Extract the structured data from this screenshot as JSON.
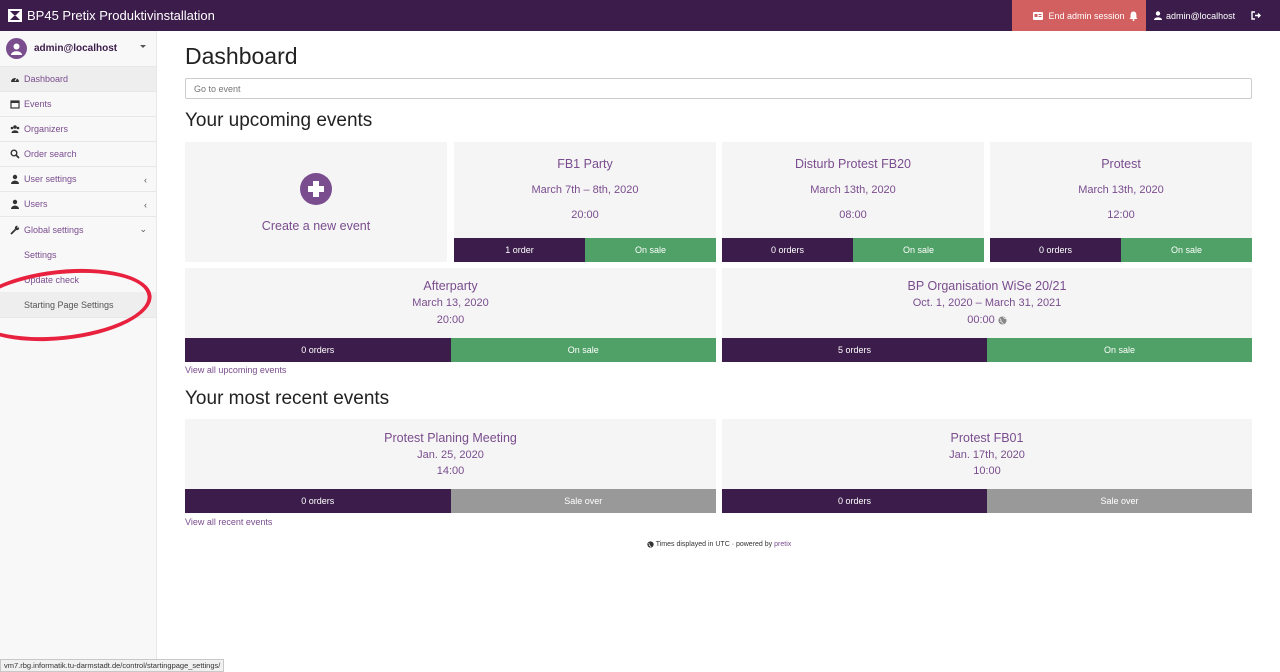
{
  "header": {
    "app_title": "BP45 Pretix Produktivinstallation",
    "end_admin_label": "End admin session",
    "user_label": "admin@localhost",
    "colors": {
      "topbar": "#3b1c4a",
      "end_admin": "#d36060"
    }
  },
  "sidebar": {
    "user": "admin@localhost",
    "items": [
      {
        "label": "Dashboard",
        "icon": "dashboard-icon"
      },
      {
        "label": "Events",
        "icon": "calendar-icon"
      },
      {
        "label": "Organizers",
        "icon": "group-icon"
      },
      {
        "label": "Order search",
        "icon": "search-icon"
      },
      {
        "label": "User settings",
        "icon": "user-icon"
      },
      {
        "label": "Users",
        "icon": "user-icon"
      },
      {
        "label": "Global settings",
        "icon": "wrench-icon"
      }
    ],
    "subitems": [
      {
        "label": "Settings"
      },
      {
        "label": "Update check"
      },
      {
        "label": "Starting Page Settings"
      }
    ]
  },
  "main": {
    "title": "Dashboard",
    "goto_placeholder": "Go to event",
    "upcoming_title": "Your upcoming events",
    "create_label": "Create a new event",
    "upcoming": [
      {
        "name": "FB1 Party",
        "date": "March 7th – 8th, 2020",
        "time": "20:00",
        "orders": "1 order",
        "status": "On sale"
      },
      {
        "name": "Disturb Protest FB20",
        "date": "March 13th, 2020",
        "time": "08:00",
        "orders": "0 orders",
        "status": "On sale"
      },
      {
        "name": "Protest",
        "date": "March 13th, 2020",
        "time": "12:00",
        "orders": "0 orders",
        "status": "On sale"
      },
      {
        "name": "Afterparty",
        "date": "March 13, 2020",
        "time": "20:00",
        "orders": "0 orders",
        "status": "On sale"
      },
      {
        "name": "BP Organisation WiSe 20/21",
        "date": "Oct. 1, 2020 – March 31, 2021",
        "time": "00:00",
        "orders": "5 orders",
        "status": "On sale"
      }
    ],
    "view_all_upcoming": "View all upcoming events",
    "recent_title": "Your most recent events",
    "recent": [
      {
        "name": "Protest Planing Meeting",
        "date": "Jan. 25, 2020",
        "time": "14:00",
        "orders": "0 orders",
        "status": "Sale over"
      },
      {
        "name": "Protest FB01",
        "date": "Jan. 17th, 2020",
        "time": "10:00",
        "orders": "0 orders",
        "status": "Sale over"
      }
    ],
    "view_all_recent": "View all recent events",
    "footer_text": "Times displayed in UTC · powered by",
    "footer_link": "pretix"
  },
  "statusbar": {
    "url": "vm7.rbg.informatik.tu-darmstadt.de/control/startingpage_settings/"
  },
  "colors": {
    "accent": "#7a4d8e",
    "dark": "#3b1c4a",
    "on_sale": "#50a167",
    "sale_over": "#999999",
    "annotation": "#e8213f"
  }
}
